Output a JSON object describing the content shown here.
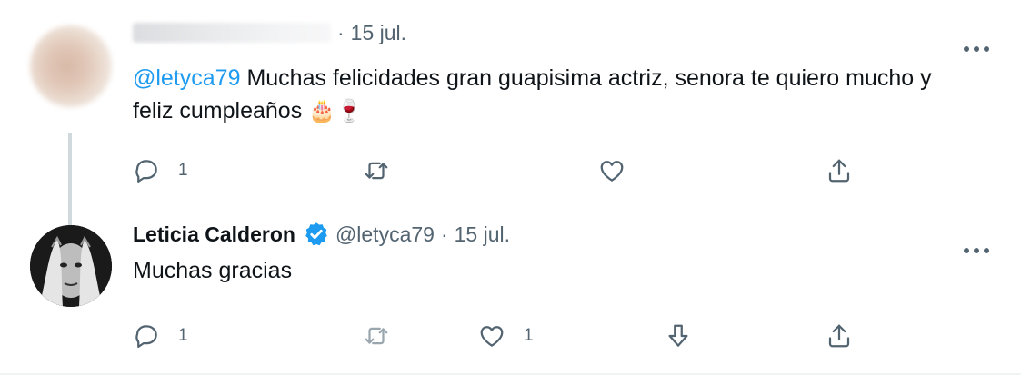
{
  "colors": {
    "link": "#1d9bf0",
    "secondary_text": "#536471",
    "primary_text": "#0f1419",
    "verified_badge": "#1d9bf0",
    "thread_line": "#cfd9de"
  },
  "icons": {
    "more": "more-horizontal-icon",
    "reply": "reply-bubble-icon",
    "retweet": "retweet-icon",
    "like": "heart-icon",
    "download": "download-arrow-icon",
    "share": "share-icon",
    "verified": "verified-badge-icon"
  },
  "tweets": [
    {
      "author_name": "",
      "handle": "",
      "separator": "·",
      "date": "15 jul.",
      "mention": "@letyca79",
      "text": " Muchas felicidades gran guapisima actriz, senora te quiero mucho y feliz cumpleaños ",
      "emoji": "🎂🍷",
      "reply_count": "1",
      "retweet_count": "",
      "like_count": ""
    },
    {
      "author_name": "Leticia Calderon",
      "handle": "@letyca79",
      "separator": "·",
      "date": "15 jul.",
      "text": "Muchas gracias",
      "reply_count": "1",
      "retweet_count": "",
      "like_count": "1"
    }
  ]
}
